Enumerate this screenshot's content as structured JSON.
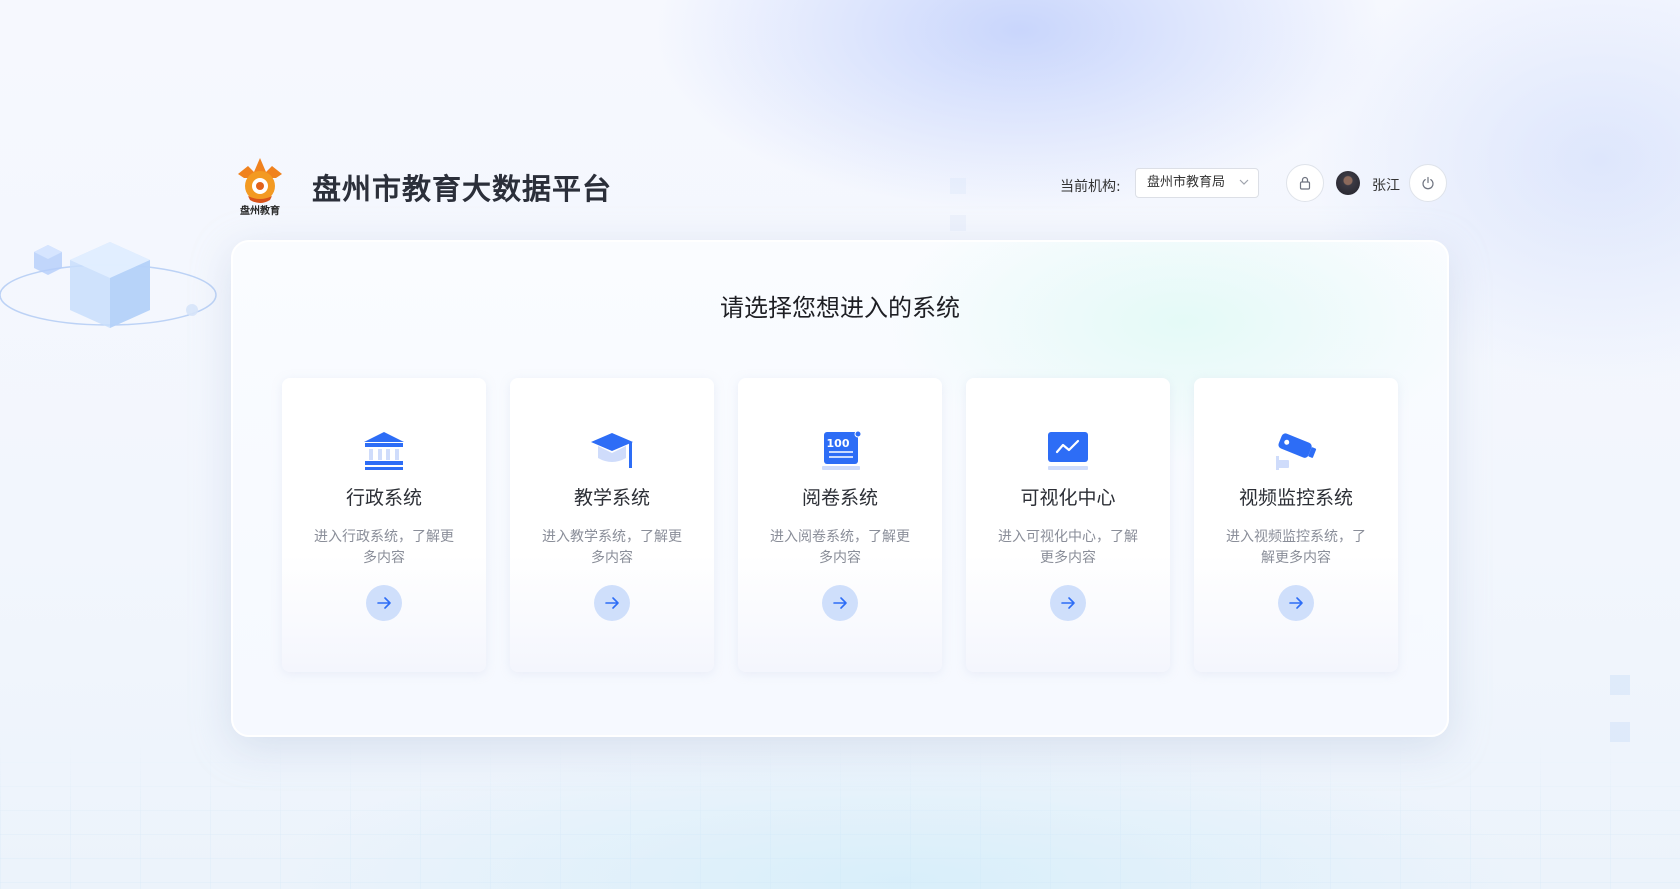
{
  "header": {
    "app_title": "盘州市教育大数据平台",
    "logo_text": "盘州教育",
    "org_label": "当前机构:",
    "org_selected": "盘州市教育局",
    "user_name": "张江"
  },
  "main": {
    "title": "请选择您想进入的系统",
    "cards": [
      {
        "title": "行政系统",
        "desc": "进入行政系统，了解更多内容",
        "icon": "bank-icon"
      },
      {
        "title": "教学系统",
        "desc": "进入教学系统，了解更多内容",
        "icon": "graduation-cap-icon"
      },
      {
        "title": "阅卷系统",
        "desc": "进入阅卷系统，了解更多内容",
        "icon": "score-100-icon"
      },
      {
        "title": "可视化中心",
        "desc": "进入可视化中心，了解更多内容",
        "icon": "line-chart-icon"
      },
      {
        "title": "视频监控系统",
        "desc": "进入视频监控系统，了解更多内容",
        "icon": "cctv-camera-icon"
      }
    ]
  },
  "colors": {
    "accent": "#2d6df6",
    "arrow_bg": "#cfdffb",
    "title_text": "#2b2f3a"
  }
}
